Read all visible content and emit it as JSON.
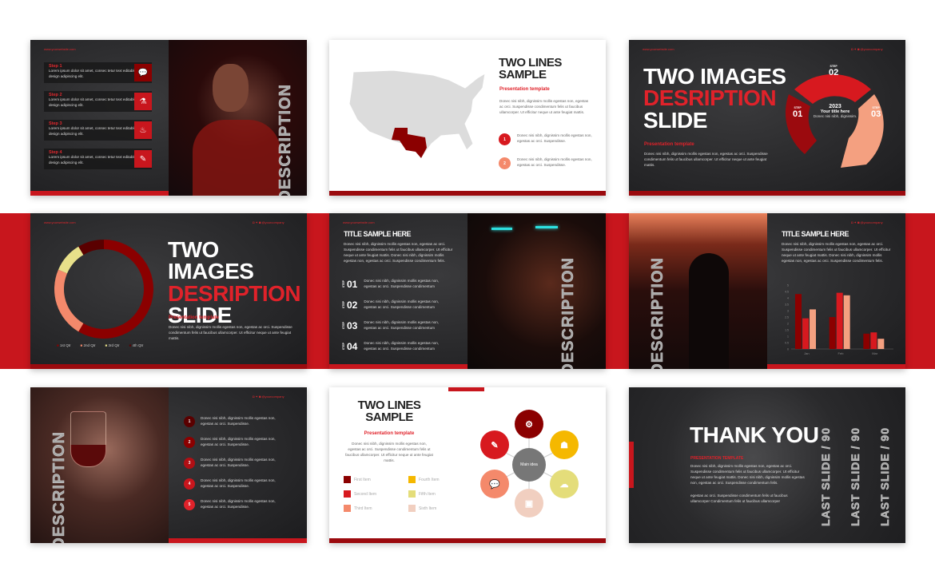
{
  "colors": {
    "band": "#c8161d",
    "maroon": "#8b0000",
    "red": "#d7191f",
    "salmon": "#f4896b",
    "yellow": "#f5b800",
    "pale_yellow": "#e4dd7a",
    "blush": "#f1cfc0",
    "grey": "#777777"
  },
  "common": {
    "url": "www.yourwebsite.com",
    "handle": "@yourcompany",
    "social_icons": [
      "instagram-icon",
      "twitter-icon",
      "facebook-icon"
    ],
    "lorem_short": "Donec nisi nibh, dignissim mollis egestas non, egestas ac orci. Suspendisse.",
    "lorem_step": "Donec nisi nibh, dignissim mollis egestas non, egestas ac orci. Suspendisse condimentum",
    "lorem_long": "Donec nisi nibh, dignissim mollis egestas non, egestas ac orci. Suspendisse condimentum felis ut faucibus ullamcorper. Ut efficitur neque ut ante feugiat mattis.",
    "lorem_para": "Donec nisi nibh, dignissim mollis egestas non, egestas ac orci. Suspendisse condimentum felis ut faucibus ullamcorper. Ut efficitur neque ut ante feugiat mattis. Donec nisi nibh, dignissim mollis egestas non, egestas ac orci. Suspendisse condimentum felis."
  },
  "slide1": {
    "steps": [
      {
        "label": "Step 1",
        "text": "Lorem ipsum dolor sit amet, consec tetur text editable here design adipiscing elit.",
        "icon": "chat-icon"
      },
      {
        "label": "Step 2",
        "text": "Lorem ipsum dolor sit amet, consec tetur text editable here design adipiscing elit.",
        "icon": "flask-icon"
      },
      {
        "label": "Step 3",
        "text": "Lorem ipsum dolor sit amet, consec tetur text editable here design adipiscing elit.",
        "icon": "fire-icon"
      },
      {
        "label": "Step 4",
        "text": "Lorem ipsum dolor sit amet, consec tetur text editable here design adipiscing elit.",
        "icon": "pencil-icon"
      }
    ],
    "vertical": "DESCRIPTION"
  },
  "slide2": {
    "title1": "TWO LINES",
    "title2": "SAMPLE",
    "subtitle": "Presentation template",
    "items": [
      "1",
      "2"
    ],
    "highlight": "Texas"
  },
  "slide3": {
    "title1": "TWO IMAGES",
    "title2": "DESRIPTION",
    "title3": "SLIDE",
    "subtitle": "Presentation template",
    "steps": [
      {
        "label": "STEP",
        "num": "01"
      },
      {
        "label": "STEP",
        "num": "02"
      },
      {
        "label": "STEP",
        "num": "03"
      }
    ],
    "center_year": "2023",
    "center_title": "Your title here",
    "center_text": "Donec nisi nibh, dignissim."
  },
  "slide5": {
    "title": "TITLE SAMPLE HERE",
    "step_label": "STEP",
    "steps": [
      "01",
      "02",
      "03",
      "04"
    ],
    "vertical": "DESCRIPTION"
  },
  "slide6": {
    "title": "TITLE SAMPLE HERE",
    "vertical": "DESCRIPTION"
  },
  "slide7": {
    "items": [
      "1",
      "2",
      "3",
      "4",
      "5"
    ],
    "vertical": "DESCRIPTION"
  },
  "slide8": {
    "title1": "TWO LINES",
    "title2": "SAMPLE",
    "subtitle": "Presentation template",
    "center": "Main idea",
    "legend": [
      "First Item",
      "Second Item",
      "Third Item",
      "Fourth Item",
      "Fifth Item",
      "Sixth Item"
    ]
  },
  "slide9": {
    "title": "THANK YOU",
    "subtitle": "PRESENTATION TEMPLATE",
    "p2": "egestas ac orci. Suspendisse condimentum felis ut faucibus ullamcorper Condimentum felis ut faucibus ullamcorper",
    "vertical": "LAST SLIDE / 90"
  },
  "chart_data": [
    {
      "type": "pie",
      "variant": "donut",
      "categories": [
        "1st Qtr",
        "2nd Qtr",
        "3rd Qtr",
        "4th Qtr"
      ],
      "values": [
        8.2,
        3.2,
        1.4,
        1.2
      ],
      "colors": [
        "#8b0000",
        "#f4896b",
        "#e8e08a",
        "#5a0000"
      ],
      "legend": "bottom"
    },
    {
      "type": "bar",
      "categories": [
        "Jan",
        "Feb",
        "Mar"
      ],
      "series": [
        {
          "values": [
            4.3,
            2.5,
            1.2
          ],
          "color": "#8b0000"
        },
        {
          "values": [
            2.4,
            4.4,
            1.3
          ],
          "color": "#d7191f"
        },
        {
          "values": [
            3.1,
            4.2,
            0.8
          ],
          "color": "#f4a080"
        }
      ],
      "ylim": [
        0,
        5
      ],
      "yticks": [
        "0",
        "0.5",
        "1",
        "1.5",
        "2",
        "2.5",
        "3",
        "3.5",
        "4",
        "4.5",
        "5"
      ]
    }
  ]
}
